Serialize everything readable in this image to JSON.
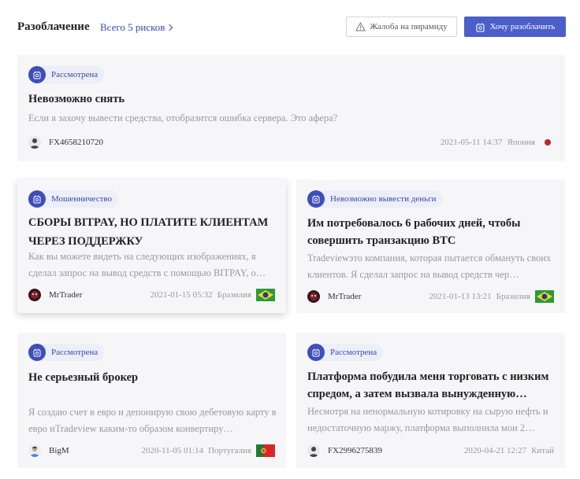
{
  "header": {
    "title": "Разоблачение",
    "total_link": "Всего 5 рисков",
    "complaint_button": "Жалоба на пирамиду",
    "expose_button": "Хочу разоблачить"
  },
  "cards": [
    {
      "status": "Рассмотрена",
      "title": "Невозможно снять",
      "description": "Если я захочу вывести средства, отобразится ошибка сервера. Это афера?",
      "user": "FX4658210720",
      "datetime": "2021-05-11 14:37",
      "country": "Япония",
      "flag": "japan-flag"
    },
    {
      "status": "Мошенничество",
      "title": "СБОРЫ BITPAY, НО ПЛАТИТЕ КЛИЕНТАМ ЧЕРЕЗ ПОДДЕРЖКУ",
      "description": "Как вы можете видеть на следующих изображениях, я сделал запрос на вывод средств с помощью BITPAY, о…",
      "user": "MrTrader",
      "datetime": "2021-01-15 05:32",
      "country": "Бразилия",
      "flag": "brazil-flag"
    },
    {
      "status": "Невозможно вывести деньги",
      "title": "Им потребовалось 6 рабочих дней, чтобы совершить транзакцию BTC",
      "description": "Tradeviewэто компания, которая пытается обмануть своих клиентов. Я сделал запрос на вывод средств чер…",
      "user": "MrTrader",
      "datetime": "2021-01-13 13:21",
      "country": "Бразилия",
      "flag": "brazil-flag"
    },
    {
      "status": "Рассмотрена",
      "title": "Не серьезный брокер",
      "description": "Я создаю счет в евро и депонирую свою дебетовую карту в евро иTradeview каким-то образом конвертиру…",
      "user": "BigM",
      "datetime": "2020-11-05 01:14",
      "country": "Португалия",
      "flag": "portugal-flag"
    },
    {
      "status": "Рассмотрена",
      "title": "Платформа побудила меня торговать с низким спредом, а затем вызвала вынужденную…",
      "description": "Несмотря на ненормальную котировку на сырую нефть и недостаточную маржу, платформа выполнила мои 2…",
      "user": "FX2996275839",
      "datetime": "2020-04-21 12:27",
      "country": "Китай",
      "flag": ""
    }
  ],
  "colors": {
    "accent": "#4b5ec9",
    "badge_text": "#3a4aa8",
    "card_bg": "#f6f6f8",
    "japan_dot": "#b8282a"
  }
}
